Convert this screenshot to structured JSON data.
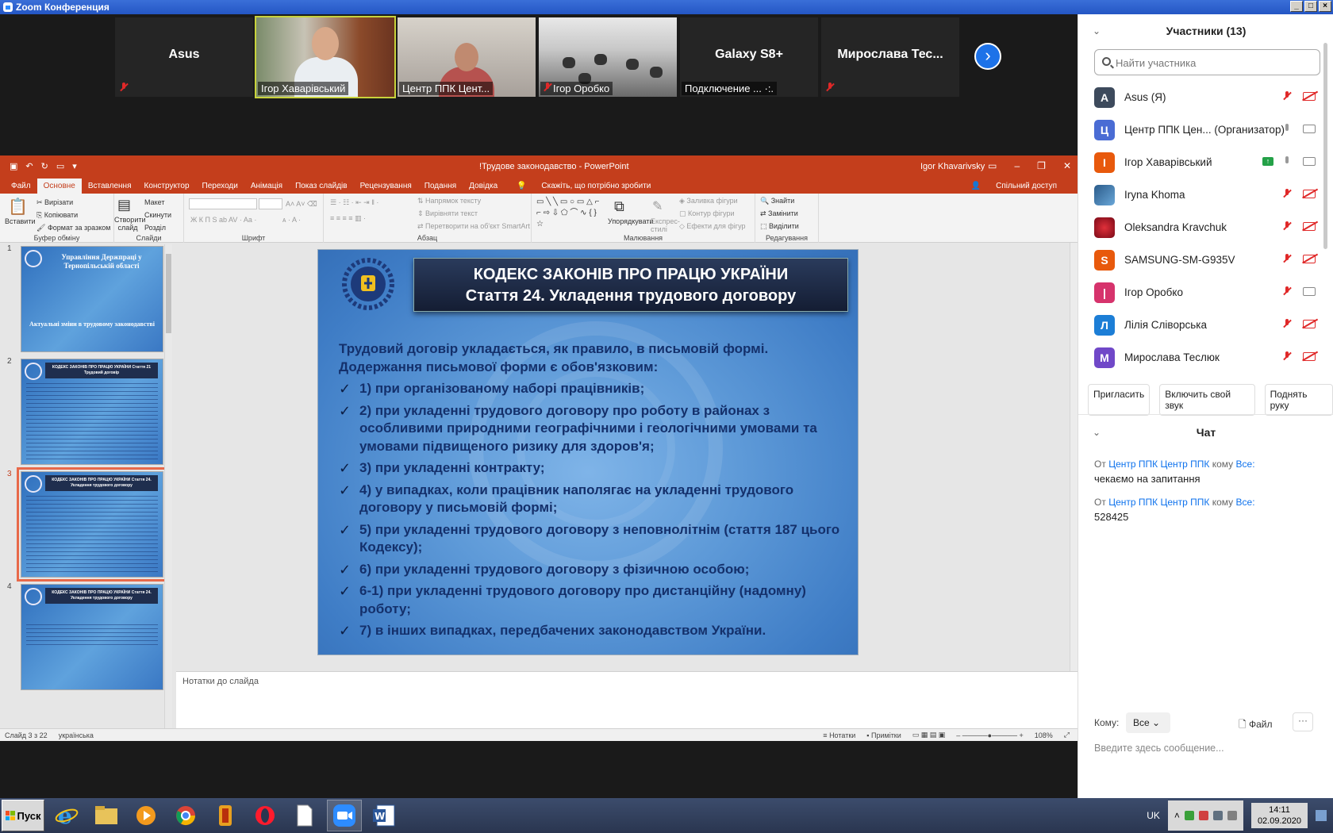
{
  "window": {
    "title": "Zoom Конференция"
  },
  "video_strip": {
    "tiles": [
      {
        "name": "Asus",
        "label": ""
      },
      {
        "name": "",
        "label": "Ігор Хаварівський"
      },
      {
        "name": "",
        "label": "Центр ППК Цент..."
      },
      {
        "name": "",
        "label": "Ігор Оробко"
      },
      {
        "name": "Galaxy S8+",
        "label": "Подключение ... ·:."
      },
      {
        "name": "Мирослава  Тес...",
        "label": ""
      }
    ]
  },
  "ppt": {
    "doc_title": "!Трудове законодавство  -  PowerPoint",
    "user": "Igor Khavarivsky",
    "tabs": [
      "Файл",
      "Основне",
      "Вставлення",
      "Конструктор",
      "Переходи",
      "Анімація",
      "Показ слайдів",
      "Рецензування",
      "Подання",
      "Довідка",
      "Скажіть, що потрібно зробити"
    ],
    "share": "Спільний доступ",
    "ribbon": {
      "paste": "Вставити",
      "cut": "Вирізати",
      "copy": "Копіювати",
      "format_painter": "Формат за зразком",
      "clipboard": "Буфер обміну",
      "new_slide": "Створити слайд",
      "layout": "Макет",
      "reset": "Скинути",
      "section": "Розділ",
      "slides": "Слайди",
      "font": "Шрифт",
      "text_direction": "Напрямок тексту",
      "align_text": "Вирівняти текст",
      "smartart": "Перетворити на об'єкт SmartArt",
      "paragraph": "Абзац",
      "arrange": "Упорядкувати",
      "quick_styles": "Експрес-стилі",
      "shape_fill": "Заливка фігури",
      "shape_outline": "Контур фігури",
      "shape_effects": "Ефекти для фігур",
      "drawing": "Малювання",
      "find": "Знайти",
      "replace": "Замінити",
      "select": "Виділити",
      "editing": "Редагування"
    },
    "thumbs": [
      {
        "num": "1",
        "title": "Управління Держпраці у Тернопільській області",
        "sub": "Актуальні зміни в трудовому законодавстві"
      },
      {
        "num": "2",
        "title": "КОДЕКС ЗАКОНІВ ПРО ПРАЦЮ УКРАЇНИ Стаття 21 Трудовий договір"
      },
      {
        "num": "3",
        "title": "КОДЕКС ЗАКОНІВ ПРО ПРАЦЮ УКРАЇНИ Стаття 24. Укладення трудового договору"
      },
      {
        "num": "4",
        "title": "КОДЕКС ЗАКОНІВ ПРО ПРАЦЮ УКРАЇНИ Стаття 24. Укладення трудового договору"
      }
    ],
    "slide": {
      "head1": "КОДЕКС ЗАКОНІВ ПРО ПРАЦЮ УКРАЇНИ",
      "head2": "Стаття 24. Укладення трудового договору",
      "intro": "Трудовий договір укладається, як правило, в письмовій формі. Додержання письмової форми є обов'язковим:",
      "items": [
        "1) при організованому наборі працівників;",
        "2) при укладенні трудового договору про роботу в районах з особливими природними географічними і геологічними умовами та умовами підвищеного ризику для здоров'я;",
        "3) при укладенні контракту;",
        "4) у випадках, коли працівник наполягає на укладенні трудового договору у письмовій формі;",
        "5) при укладенні трудового договору з неповнолітнім (стаття 187 цього Кодексу);",
        "6) при укладенні трудового договору з фізичною особою;",
        "6-1) при укладенні трудового договору про дистанційну (надомну) роботу;",
        "7) в інших випадках, передбачених законодавством України."
      ]
    },
    "notes": "Нотатки до слайда",
    "status": {
      "slide": "Слайд 3 з 22",
      "lang": "українська",
      "notes": "Нотатки",
      "comments": "Примітки",
      "zoom": "108%"
    }
  },
  "participants": {
    "header": "Участники (13)",
    "search_placeholder": "Найти участника",
    "list": [
      {
        "initial": "A",
        "name": "Asus (Я)",
        "color": "#3d4a5c",
        "muted": true,
        "cam": false
      },
      {
        "initial": "Ц",
        "name": "Центр ППК Цен... (Организатор)",
        "color": "#4a6cd4",
        "muted": false,
        "cam": true
      },
      {
        "initial": "І",
        "name": "Ігор Хаварівський",
        "color": "#e8590c",
        "muted": false,
        "cam": true,
        "share": "↑"
      },
      {
        "initial": "",
        "name": "Iryna Khoma",
        "color": "#2a5b8a",
        "muted": true,
        "cam": false
      },
      {
        "initial": "",
        "name": "Oleksandra Kravchuk",
        "color": "#b0182a",
        "muted": true,
        "cam": false
      },
      {
        "initial": "S",
        "name": "SAMSUNG-SM-G935V",
        "color": "#e8590c",
        "muted": true,
        "cam": false
      },
      {
        "initial": "|",
        "name": "Ігор Оробко",
        "color": "#d6336c",
        "muted": true,
        "cam": true
      },
      {
        "initial": "Л",
        "name": "Лілія Сліворська",
        "color": "#1c7ed6",
        "muted": true,
        "cam": false
      },
      {
        "initial": "М",
        "name": "Мирослава Теслюк",
        "color": "#7048c8",
        "muted": true,
        "cam": false
      }
    ],
    "buttons": [
      "Пригласить",
      "Включить свой звук",
      "Поднять руку"
    ]
  },
  "chat": {
    "header": "Чат",
    "messages": [
      {
        "from_label": "От",
        "from": "Центр ППК Центр ППК",
        "to_label": "кому",
        "to": "Все:",
        "text": "чекаємо на запитання"
      },
      {
        "from_label": "От",
        "from": "Центр ППК Центр ППК",
        "to_label": "кому",
        "to": "Все:",
        "text": "528425"
      }
    ],
    "to_label": "Кому:",
    "to_value": "Все",
    "file": "Файл",
    "more": "···",
    "placeholder": "Введите здесь сообщение..."
  },
  "taskbar": {
    "start": "Пуск",
    "lang": "UK",
    "time": "14:11",
    "date": "02.09.2020"
  }
}
